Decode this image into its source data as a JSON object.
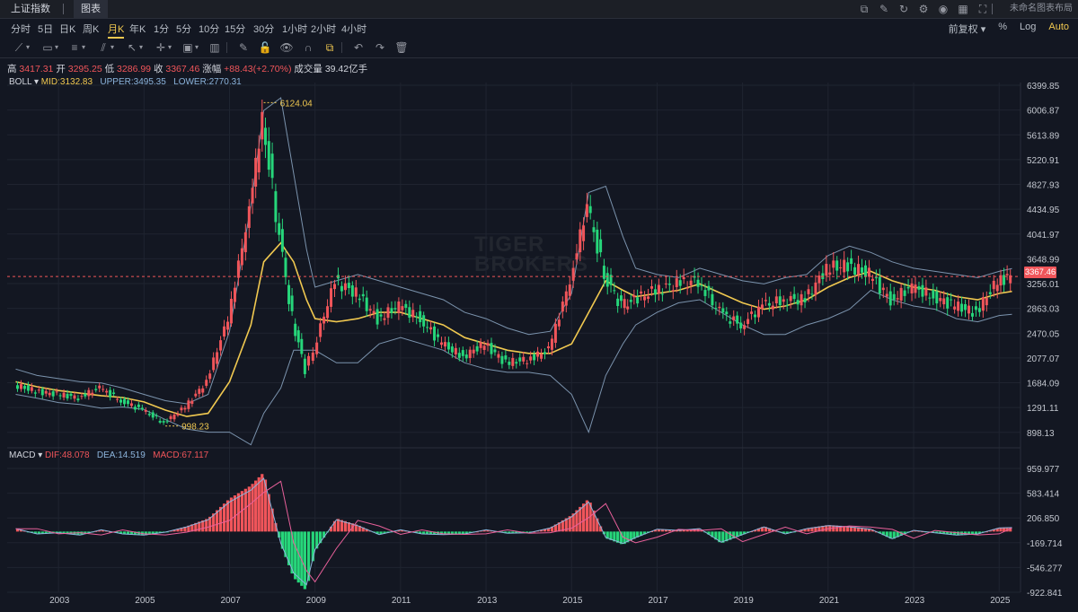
{
  "topbar": {
    "tab_index": "上证指数",
    "tab_chart": "图表",
    "layout_name": "未命名图表布局"
  },
  "periods": [
    "分时",
    "5日",
    "日K",
    "周K",
    "月K",
    "年K",
    "1分",
    "5分",
    "10分",
    "15分",
    "30分",
    "1小时",
    "2小时",
    "4小时"
  ],
  "active_period": "月K",
  "right_options": {
    "adjust": "前复权 ▾",
    "percent": "%",
    "log": "Log",
    "auto": "Auto"
  },
  "info": {
    "high_label": "高",
    "high": "3417.31",
    "open_label": "开",
    "open": "3295.25",
    "low_label": "低",
    "low": "3286.99",
    "close_label": "收",
    "close": "3367.46",
    "chg_label": "涨幅",
    "chg": "+88.43(+2.70%)",
    "vol_label": "成交量",
    "vol": "39.42亿手"
  },
  "boll": {
    "name": "BOLL",
    "mid": "MID:3132.83",
    "upper": "UPPER:3495.35",
    "lower": "LOWER:2770.31"
  },
  "macd": {
    "name": "MACD",
    "dif": "DIF:48.078",
    "dea": "DEA:14.519",
    "macd": "MACD:67.117"
  },
  "price_axis": [
    "6399.85",
    "6006.87",
    "5613.89",
    "5220.91",
    "4827.93",
    "4434.95",
    "4041.97",
    "3648.99",
    "3256.01",
    "2863.03",
    "2470.05",
    "2077.07",
    "1684.09",
    "1291.11",
    "898.13"
  ],
  "macd_axis": [
    "959.977",
    "583.414",
    "206.850",
    "-169.714",
    "-546.277",
    "-922.841"
  ],
  "x_axis": [
    "2003",
    "2005",
    "2007",
    "2009",
    "2011",
    "2013",
    "2015",
    "2017",
    "2019",
    "2021",
    "2023",
    "2025"
  ],
  "last_price_tag": "3367.46",
  "markers": {
    "high": "6124.04",
    "low": "998.23"
  },
  "watermark": [
    "TIGER",
    "BROKERS"
  ],
  "icons": [
    "layout-icon",
    "edit-icon",
    "refresh-icon",
    "settings-icon",
    "camera-icon",
    "grid-icon",
    "fullscreen-icon"
  ],
  "colors": {
    "up": "#f0555a",
    "down": "#26d67a",
    "mid": "#f0c850",
    "band": "#7b93ad",
    "dif": "#8cb4dc",
    "dea": "#e8609a"
  },
  "chart_data": {
    "type": "candlestick",
    "title": "上证指数 月K",
    "x": [
      2002.0,
      2002.5,
      2003.0,
      2003.5,
      2004.0,
      2004.5,
      2005.0,
      2005.5,
      2006.0,
      2006.5,
      2007.0,
      2007.5,
      2007.8,
      2008.2,
      2008.5,
      2008.8,
      2009.0,
      2009.5,
      2010.0,
      2010.5,
      2011.0,
      2011.5,
      2012.0,
      2012.5,
      2013.0,
      2013.5,
      2014.0,
      2014.5,
      2015.0,
      2015.4,
      2015.8,
      2016.2,
      2016.5,
      2017.0,
      2017.5,
      2018.0,
      2018.5,
      2019.0,
      2019.5,
      2020.0,
      2020.5,
      2021.0,
      2021.5,
      2022.0,
      2022.5,
      2023.0,
      2023.5,
      2024.0,
      2024.5,
      2025.0,
      2025.3
    ],
    "close": [
      1650,
      1550,
      1500,
      1450,
      1600,
      1400,
      1250,
      1050,
      1300,
      1700,
      2700,
      4400,
      5900,
      4000,
      2700,
      1900,
      2200,
      3300,
      3100,
      2700,
      2900,
      2700,
      2300,
      2100,
      2300,
      2000,
      2050,
      2200,
      3300,
      4500,
      3400,
      2900,
      3000,
      3150,
      3250,
      3300,
      2800,
      2600,
      2900,
      3000,
      3000,
      3500,
      3550,
      3400,
      3000,
      3200,
      3050,
      2900,
      2800,
      3300,
      3367.46
    ],
    "boll_mid": [
      1700,
      1620,
      1560,
      1520,
      1480,
      1450,
      1380,
      1250,
      1150,
      1200,
      1700,
      2600,
      3600,
      3900,
      3600,
      3000,
      2700,
      2650,
      2700,
      2800,
      2800,
      2700,
      2600,
      2400,
      2300,
      2200,
      2150,
      2150,
      2300,
      2800,
      3300,
      3150,
      3050,
      3100,
      3150,
      3250,
      3100,
      2950,
      2850,
      2900,
      3000,
      3200,
      3350,
      3450,
      3300,
      3200,
      3150,
      3050,
      3000,
      3100,
      3132.83
    ],
    "boll_upper": [
      1900,
      1800,
      1750,
      1700,
      1680,
      1600,
      1500,
      1400,
      1350,
      1500,
      2500,
      4500,
      6000,
      6200,
      5000,
      3800,
      3200,
      3300,
      3400,
      3300,
      3200,
      3100,
      3000,
      2800,
      2700,
      2550,
      2450,
      2500,
      3100,
      4700,
      4800,
      4000,
      3500,
      3400,
      3350,
      3500,
      3400,
      3300,
      3250,
      3350,
      3400,
      3700,
      3850,
      3750,
      3600,
      3500,
      3450,
      3400,
      3350,
      3450,
      3495.35
    ],
    "boll_lower": [
      1500,
      1440,
      1370,
      1340,
      1280,
      1300,
      1260,
      1100,
      950,
      900,
      900,
      700,
      1200,
      1600,
      2200,
      2200,
      2200,
      2000,
      2000,
      2300,
      2400,
      2300,
      2200,
      2000,
      1900,
      1850,
      1850,
      1800,
      1500,
      900,
      1800,
      2300,
      2600,
      2800,
      2950,
      3000,
      2800,
      2600,
      2450,
      2450,
      2600,
      2700,
      2850,
      3150,
      3000,
      2900,
      2850,
      2700,
      2650,
      2750,
      2770.31
    ],
    "macd_hist": [
      50,
      -40,
      -20,
      -60,
      30,
      -40,
      -60,
      -10,
      80,
      200,
      500,
      700,
      900,
      -200,
      -700,
      -900,
      -300,
      200,
      100,
      -50,
      30,
      -40,
      -50,
      -40,
      30,
      -30,
      -20,
      60,
      250,
      500,
      -100,
      -200,
      -100,
      40,
      20,
      50,
      -180,
      -50,
      80,
      -40,
      50,
      100,
      80,
      40,
      -120,
      20,
      -20,
      -60,
      -40,
      60,
      67.117
    ],
    "ylim": [
      898.13,
      6399.85
    ],
    "macd_ylim": [
      -922.841,
      959.977
    ],
    "xlim": [
      2001.8,
      2025.5
    ],
    "ylabel": "",
    "grid": true
  }
}
